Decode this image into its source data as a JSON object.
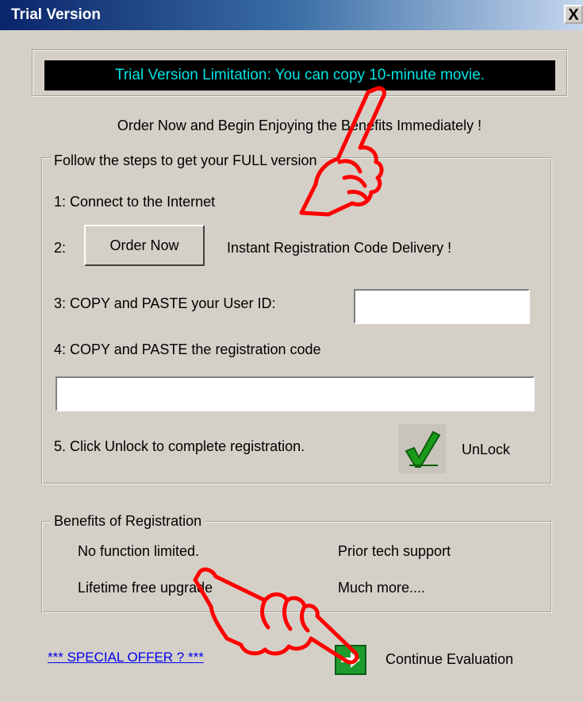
{
  "window": {
    "title": "Trial Version",
    "close_label": "X"
  },
  "notice": {
    "text": "Trial Version Limitation:  You can copy 10-minute movie."
  },
  "order_heading": "Order Now and Begin Enjoying the Benefits Immediately !",
  "steps": {
    "legend": "Follow the steps to get your FULL version",
    "step1": "1: Connect to the Internet",
    "step2_prefix": "2:",
    "order_button_label": "Order Now",
    "instant_text": "Instant Registration Code Delivery !",
    "step3": "3: COPY and PASTE your User ID:",
    "user_id_value": "",
    "step4": "4: COPY and PASTE the registration code",
    "reg_code_value": "",
    "step5": "5. Click Unlock to complete registration.",
    "unlock_label": "UnLock"
  },
  "benefits": {
    "legend": "Benefits of Registration",
    "items": [
      "No function limited.",
      "Prior tech support",
      "Lifetime free upgrade",
      "Much more...."
    ]
  },
  "footer": {
    "special_offer": "*** SPECIAL OFFER ? ***",
    "continue_label": "Continue Evaluation"
  },
  "colors": {
    "notice_text": "#00e5e5",
    "link": "#0000ee",
    "hand_outline": "#ff0000",
    "checkmark": "#1a9b1a",
    "continue_icon": "#1d9b2f"
  },
  "icons": {
    "unlock": "checkmark-icon",
    "continue": "green-arrow-icon",
    "pointer": "pointing-hand-icon"
  }
}
